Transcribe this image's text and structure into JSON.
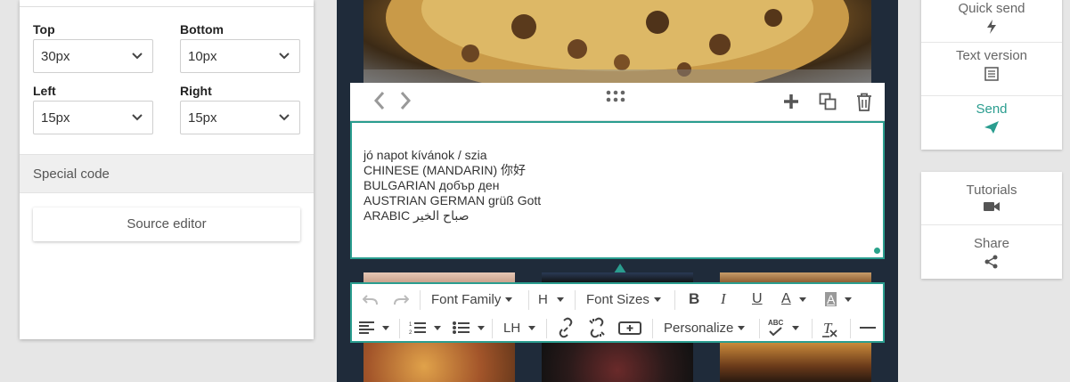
{
  "padding": {
    "top": {
      "label": "Top",
      "value": "30px"
    },
    "bottom": {
      "label": "Bottom",
      "value": "10px"
    },
    "left": {
      "label": "Left",
      "value": "15px"
    },
    "right": {
      "label": "Right",
      "value": "15px"
    }
  },
  "special_code": {
    "label": "Special code",
    "source_editor_label": "Source editor"
  },
  "editor": {
    "lines": [
      "jó napot kívánok / szia",
      "CHINESE (MANDARIN) 你好",
      "BULGARIAN добър ден",
      "AUSTRIAN GERMAN grüß Gott",
      "ARABIC صباح الخير"
    ]
  },
  "format_toolbar": {
    "font_family": "Font Family",
    "heading": "H",
    "font_sizes": "Font Sizes",
    "bold": "B",
    "italic": "I",
    "underline": "U",
    "font_color": "A",
    "bg_color": "A",
    "line_height": "LH",
    "personalize": "Personalize",
    "spellcheck": "ABC"
  },
  "right_panel": {
    "quick_send": "Quick send",
    "text_version": "Text version",
    "send": "Send",
    "tutorials": "Tutorials",
    "share": "Share"
  },
  "colors": {
    "accent": "#2a9d8f",
    "email_bg": "#1f2b3a",
    "panel_bg": "#ffffff",
    "page_bg": "#e6e6e6"
  }
}
